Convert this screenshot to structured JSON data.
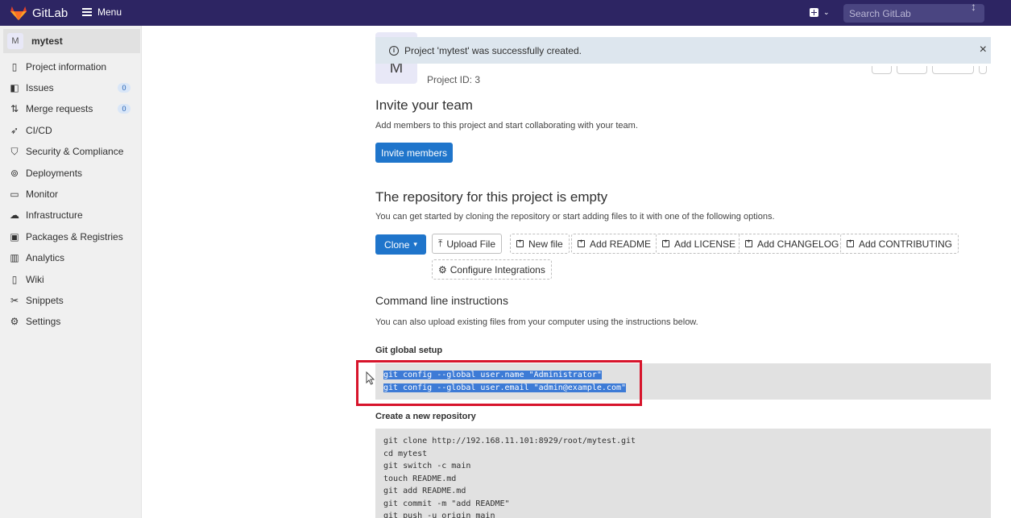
{
  "topbar": {
    "app_name": "GitLab",
    "menu_label": "Menu",
    "create_icon": "plus-square-icon",
    "search_placeholder": "Search GitLab",
    "brand_color": "#2d2563"
  },
  "sidebar": {
    "project_avatar_letter": "M",
    "project_name": "mytest",
    "items": [
      {
        "label": "Project information",
        "icon": "project-info-icon"
      },
      {
        "label": "Issues",
        "icon": "issues-icon",
        "badge": "0"
      },
      {
        "label": "Merge requests",
        "icon": "merge-request-icon",
        "badge": "0"
      },
      {
        "label": "CI/CD",
        "icon": "rocket-icon"
      },
      {
        "label": "Security & Compliance",
        "icon": "shield-icon"
      },
      {
        "label": "Deployments",
        "icon": "deployments-icon"
      },
      {
        "label": "Monitor",
        "icon": "monitor-icon"
      },
      {
        "label": "Infrastructure",
        "icon": "cloud-icon"
      },
      {
        "label": "Packages & Registries",
        "icon": "package-icon"
      },
      {
        "label": "Analytics",
        "icon": "chart-icon"
      },
      {
        "label": "Wiki",
        "icon": "book-icon"
      },
      {
        "label": "Snippets",
        "icon": "scissors-icon"
      },
      {
        "label": "Settings",
        "icon": "gear-icon"
      }
    ]
  },
  "flash": {
    "message": "Project 'mytest' was successfully created.",
    "close": "×"
  },
  "project": {
    "avatar_letter": "M",
    "id_text": "Project ID: 3"
  },
  "invite": {
    "title": "Invite your team",
    "subtitle": "Add members to this project and start collaborating with your team.",
    "button": "Invite members"
  },
  "empty_repo": {
    "title": "The repository for this project is empty",
    "subtitle": "You can get started by cloning the repository or start adding files to it with one of the following options.",
    "clone_button": "Clone",
    "actions": [
      "Upload File",
      "New file",
      "Add README",
      "Add LICENSE",
      "Add CHANGELOG",
      "Add CONTRIBUTING"
    ],
    "configure_integrations": "Configure Integrations"
  },
  "cli": {
    "title": "Command line instructions",
    "subtitle": "You can also upload existing files from your computer using the instructions below.",
    "global_setup_title": "Git global setup",
    "global_setup_lines": [
      "git config --global user.name \"Administrator\"",
      "git config --global user.email \"admin@example.com\""
    ],
    "new_repo_title": "Create a new repository",
    "new_repo_lines": [
      "git clone http://192.168.11.101:8929/root/mytest.git",
      "cd mytest",
      "git switch -c main",
      "touch README.md",
      "git add README.md",
      "git commit -m \"add README\"",
      "git push -u origin main"
    ]
  }
}
